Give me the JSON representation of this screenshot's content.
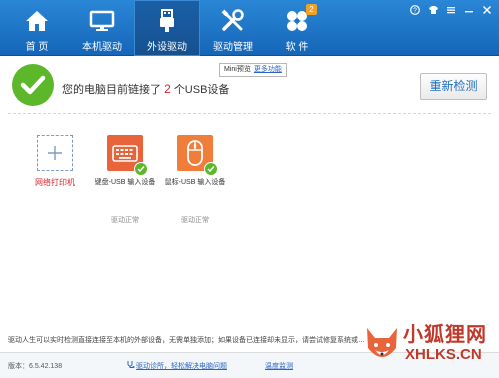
{
  "nav": {
    "items": [
      {
        "label": "首 页",
        "icon": "home-icon"
      },
      {
        "label": "本机驱动",
        "icon": "monitor-icon"
      },
      {
        "label": "外设驱动",
        "icon": "usb-plug-icon"
      },
      {
        "label": "驱动管理",
        "icon": "tools-icon"
      },
      {
        "label": "软 件",
        "icon": "apps-grid-icon"
      }
    ],
    "active": "外设驱动",
    "software_badge": "2"
  },
  "status": {
    "prefix": "您的电脑目前链接了",
    "count": "2",
    "suffix": "个USB设备"
  },
  "tooltip": {
    "text": "Mini预览",
    "link": "更多功能"
  },
  "redetect_label": "重新检测",
  "devices": [
    {
      "name": "网络打印机",
      "state": "",
      "icon": "add-icon"
    },
    {
      "name": "键盘-USB 输入设备",
      "state": "驱动正常",
      "icon": "keyboard-icon"
    },
    {
      "name": "鼠标-USB 输入设备",
      "state": "驱动正常",
      "icon": "mouse-icon"
    }
  ],
  "tip": "驱动人生可以实时检测直接连接至本机的外部设备，无需单独添加；如果设备已连接却未显示，请尝试修复系统或…",
  "footer": {
    "version": "版本：6.5.42.138",
    "diagnose_link": "驱动诊所，轻松解决电脑问题",
    "temp_link": "温度监测"
  },
  "watermark": {
    "line1": "小狐狸网",
    "line2": "XHLKS.CN"
  },
  "colors": {
    "toolbar": "#1a72c6",
    "success": "#5cb82a",
    "highlight": "#d8262c",
    "link": "#2b63c4",
    "keyboard_tile": "#e8643a",
    "mouse_tile": "#f07d3a"
  }
}
